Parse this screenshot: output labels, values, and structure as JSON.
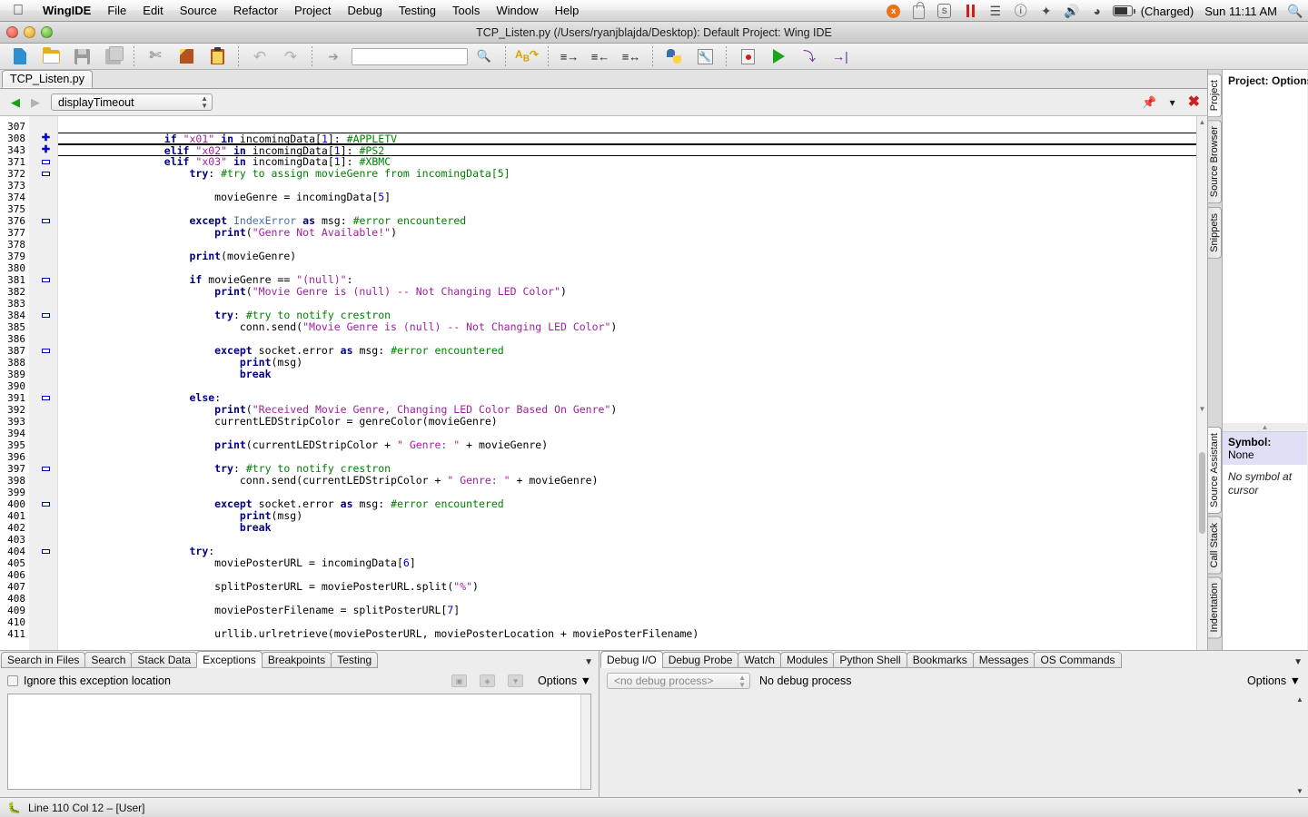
{
  "menubar": {
    "apple": "apple-logo",
    "items": [
      "WingIDE",
      "File",
      "Edit",
      "Source",
      "Refactor",
      "Project",
      "Debug",
      "Testing",
      "Tools",
      "Window",
      "Help"
    ],
    "status_icons": [
      "crashplan-icon",
      "lock-icon",
      "shield-icon",
      "pause-icon",
      "wifi-icon",
      "alert-icon",
      "bluetooth-icon",
      "volume-icon",
      "timemachine-icon",
      "battery-icon"
    ],
    "battery_text": "(Charged)",
    "clock": "Sun 11:11 AM",
    "search_icon": "spotlight-search-icon"
  },
  "window": {
    "title": "TCP_Listen.py (/Users/ryanjblajda/Desktop): Default Project: Wing IDE"
  },
  "toolbar": {
    "buttons": [
      {
        "name": "new-file-icon",
        "label": "New File"
      },
      {
        "name": "open-file-icon",
        "label": "Open File"
      },
      {
        "name": "save-file-icon",
        "label": "Save"
      },
      {
        "name": "save-all-icon",
        "label": "Save All"
      },
      {
        "name": "cut-icon",
        "label": "Cut"
      },
      {
        "name": "copy-icon",
        "label": "Copy"
      },
      {
        "name": "paste-icon",
        "label": "Paste"
      },
      {
        "name": "undo-icon",
        "label": "Undo"
      },
      {
        "name": "redo-icon",
        "label": "Redo"
      },
      {
        "name": "select-pointer-icon",
        "label": "Select"
      },
      {
        "name": "search-input",
        "label": "Search"
      },
      {
        "name": "search-magnifier-icon",
        "label": "Find"
      },
      {
        "name": "replace-abc-icon",
        "label": "Replace"
      },
      {
        "name": "indent-right-icon",
        "label": "Indent"
      },
      {
        "name": "indent-left-icon",
        "label": "Outdent"
      },
      {
        "name": "indent-toggle-icon",
        "label": "Toggle Indent"
      },
      {
        "name": "python-shell-icon",
        "label": "Python Shell"
      },
      {
        "name": "debug-probe-icon",
        "label": "Debug Probe"
      },
      {
        "name": "toggle-breakpoint-icon",
        "label": "Breakpoint"
      },
      {
        "name": "run-icon",
        "label": "Run"
      },
      {
        "name": "step-into-icon",
        "label": "Step Into"
      },
      {
        "name": "step-over-icon",
        "label": "Step Over"
      }
    ],
    "search_value": ""
  },
  "editor": {
    "tab": "TCP_Listen.py",
    "nav_back": "◀",
    "nav_forward": "▶",
    "symbol_combo": "displayTimeout",
    "right_icons": [
      "pin-icon",
      "chevron-down-icon",
      "close-icon"
    ],
    "lines": [
      {
        "n": "307",
        "mark": "",
        "sel": false,
        "tokens": []
      },
      {
        "n": "308",
        "mark": "plus",
        "sel": true,
        "tokens": [
          {
            "t": "                ",
            "c": "pln"
          },
          {
            "t": "if",
            "c": "kw"
          },
          {
            "t": " ",
            "c": "pln"
          },
          {
            "t": "\"x01\"",
            "c": "str"
          },
          {
            "t": " ",
            "c": "pln"
          },
          {
            "t": "in",
            "c": "kw"
          },
          {
            "t": " incomingData[",
            "c": "pln"
          },
          {
            "t": "1",
            "c": "num"
          },
          {
            "t": "]: ",
            "c": "pln"
          },
          {
            "t": "#APPLETV",
            "c": "cmt"
          }
        ]
      },
      {
        "n": "343",
        "mark": "plus",
        "sel": true,
        "tokens": [
          {
            "t": "                ",
            "c": "pln"
          },
          {
            "t": "elif",
            "c": "kw"
          },
          {
            "t": " ",
            "c": "pln"
          },
          {
            "t": "\"x02\"",
            "c": "str"
          },
          {
            "t": " ",
            "c": "pln"
          },
          {
            "t": "in",
            "c": "kw"
          },
          {
            "t": " incomingData[",
            "c": "pln"
          },
          {
            "t": "1",
            "c": "num"
          },
          {
            "t": "]: ",
            "c": "pln"
          },
          {
            "t": "#PS2",
            "c": "cmt"
          }
        ]
      },
      {
        "n": "371",
        "mark": "minus",
        "sel": false,
        "tokens": [
          {
            "t": "                ",
            "c": "pln"
          },
          {
            "t": "elif",
            "c": "kw"
          },
          {
            "t": " ",
            "c": "pln"
          },
          {
            "t": "\"x03\"",
            "c": "str"
          },
          {
            "t": " ",
            "c": "pln"
          },
          {
            "t": "in",
            "c": "kw"
          },
          {
            "t": " incomingData[",
            "c": "pln"
          },
          {
            "t": "1",
            "c": "num"
          },
          {
            "t": "]: ",
            "c": "pln"
          },
          {
            "t": "#XBMC",
            "c": "cmt"
          }
        ]
      },
      {
        "n": "372",
        "mark": "minus",
        "sel": false,
        "tokens": [
          {
            "t": "                    ",
            "c": "pln"
          },
          {
            "t": "try",
            "c": "kw"
          },
          {
            "t": ": ",
            "c": "pln"
          },
          {
            "t": "#try to assign movieGenre from incomingData[5]",
            "c": "cmt"
          }
        ]
      },
      {
        "n": "373",
        "mark": "",
        "sel": false,
        "tokens": []
      },
      {
        "n": "374",
        "mark": "",
        "sel": false,
        "tokens": [
          {
            "t": "                        movieGenre = incomingData[",
            "c": "pln"
          },
          {
            "t": "5",
            "c": "num"
          },
          {
            "t": "]",
            "c": "pln"
          }
        ]
      },
      {
        "n": "375",
        "mark": "",
        "sel": false,
        "tokens": []
      },
      {
        "n": "376",
        "mark": "minus",
        "sel": false,
        "tokens": [
          {
            "t": "                    ",
            "c": "pln"
          },
          {
            "t": "except",
            "c": "kw"
          },
          {
            "t": " ",
            "c": "pln"
          },
          {
            "t": "IndexError",
            "c": "bi"
          },
          {
            "t": " ",
            "c": "pln"
          },
          {
            "t": "as",
            "c": "kw"
          },
          {
            "t": " msg: ",
            "c": "pln"
          },
          {
            "t": "#error encountered",
            "c": "cmt"
          }
        ]
      },
      {
        "n": "377",
        "mark": "",
        "sel": false,
        "tokens": [
          {
            "t": "                        ",
            "c": "pln"
          },
          {
            "t": "print",
            "c": "kw"
          },
          {
            "t": "(",
            "c": "pln"
          },
          {
            "t": "\"Genre Not Available!\"",
            "c": "str"
          },
          {
            "t": ")",
            "c": "pln"
          }
        ]
      },
      {
        "n": "378",
        "mark": "",
        "sel": false,
        "tokens": []
      },
      {
        "n": "379",
        "mark": "",
        "sel": false,
        "tokens": [
          {
            "t": "                    ",
            "c": "pln"
          },
          {
            "t": "print",
            "c": "kw"
          },
          {
            "t": "(movieGenre)",
            "c": "pln"
          }
        ]
      },
      {
        "n": "380",
        "mark": "",
        "sel": false,
        "tokens": []
      },
      {
        "n": "381",
        "mark": "minus",
        "sel": false,
        "tokens": [
          {
            "t": "                    ",
            "c": "pln"
          },
          {
            "t": "if",
            "c": "kw"
          },
          {
            "t": " movieGenre == ",
            "c": "pln"
          },
          {
            "t": "\"(null)\"",
            "c": "str"
          },
          {
            "t": ":",
            "c": "pln"
          }
        ]
      },
      {
        "n": "382",
        "mark": "",
        "sel": false,
        "tokens": [
          {
            "t": "                        ",
            "c": "pln"
          },
          {
            "t": "print",
            "c": "kw"
          },
          {
            "t": "(",
            "c": "pln"
          },
          {
            "t": "\"Movie Genre is (null) -- Not Changing LED Color\"",
            "c": "str"
          },
          {
            "t": ")",
            "c": "pln"
          }
        ]
      },
      {
        "n": "383",
        "mark": "",
        "sel": false,
        "tokens": []
      },
      {
        "n": "384",
        "mark": "minus",
        "sel": false,
        "tokens": [
          {
            "t": "                        ",
            "c": "pln"
          },
          {
            "t": "try",
            "c": "kw"
          },
          {
            "t": ": ",
            "c": "pln"
          },
          {
            "t": "#try to notify crestron",
            "c": "cmt"
          }
        ]
      },
      {
        "n": "385",
        "mark": "",
        "sel": false,
        "tokens": [
          {
            "t": "                            conn.send(",
            "c": "pln"
          },
          {
            "t": "\"Movie Genre is (null) -- Not Changing LED Color\"",
            "c": "str"
          },
          {
            "t": ")",
            "c": "pln"
          }
        ]
      },
      {
        "n": "386",
        "mark": "",
        "sel": false,
        "tokens": []
      },
      {
        "n": "387",
        "mark": "minus",
        "sel": false,
        "tokens": [
          {
            "t": "                        ",
            "c": "pln"
          },
          {
            "t": "except",
            "c": "kw"
          },
          {
            "t": " socket.error ",
            "c": "pln"
          },
          {
            "t": "as",
            "c": "kw"
          },
          {
            "t": " msg: ",
            "c": "pln"
          },
          {
            "t": "#error encountered",
            "c": "cmt"
          }
        ]
      },
      {
        "n": "388",
        "mark": "",
        "sel": false,
        "tokens": [
          {
            "t": "                            ",
            "c": "pln"
          },
          {
            "t": "print",
            "c": "kw"
          },
          {
            "t": "(msg)",
            "c": "pln"
          }
        ]
      },
      {
        "n": "389",
        "mark": "",
        "sel": false,
        "tokens": [
          {
            "t": "                            ",
            "c": "pln"
          },
          {
            "t": "break",
            "c": "kw"
          }
        ]
      },
      {
        "n": "390",
        "mark": "",
        "sel": false,
        "tokens": []
      },
      {
        "n": "391",
        "mark": "minus",
        "sel": false,
        "tokens": [
          {
            "t": "                    ",
            "c": "pln"
          },
          {
            "t": "else",
            "c": "kw"
          },
          {
            "t": ":",
            "c": "pln"
          }
        ]
      },
      {
        "n": "392",
        "mark": "",
        "sel": false,
        "tokens": [
          {
            "t": "                        ",
            "c": "pln"
          },
          {
            "t": "print",
            "c": "kw"
          },
          {
            "t": "(",
            "c": "pln"
          },
          {
            "t": "\"Received Movie Genre, Changing LED Color Based On Genre\"",
            "c": "str"
          },
          {
            "t": ")",
            "c": "pln"
          }
        ]
      },
      {
        "n": "393",
        "mark": "",
        "sel": false,
        "tokens": [
          {
            "t": "                        currentLEDStripColor = genreColor(movieGenre)",
            "c": "pln"
          }
        ]
      },
      {
        "n": "394",
        "mark": "",
        "sel": false,
        "tokens": []
      },
      {
        "n": "395",
        "mark": "",
        "sel": false,
        "tokens": [
          {
            "t": "                        ",
            "c": "pln"
          },
          {
            "t": "print",
            "c": "kw"
          },
          {
            "t": "(currentLEDStripColor + ",
            "c": "pln"
          },
          {
            "t": "\" Genre: \"",
            "c": "str"
          },
          {
            "t": " + movieGenre)",
            "c": "pln"
          }
        ]
      },
      {
        "n": "396",
        "mark": "",
        "sel": false,
        "tokens": []
      },
      {
        "n": "397",
        "mark": "minus",
        "sel": false,
        "tokens": [
          {
            "t": "                        ",
            "c": "pln"
          },
          {
            "t": "try",
            "c": "kw"
          },
          {
            "t": ": ",
            "c": "pln"
          },
          {
            "t": "#try to notify crestron",
            "c": "cmt"
          }
        ]
      },
      {
        "n": "398",
        "mark": "",
        "sel": false,
        "tokens": [
          {
            "t": "                            conn.send(currentLEDStripColor + ",
            "c": "pln"
          },
          {
            "t": "\" Genre: \"",
            "c": "str"
          },
          {
            "t": " + movieGenre)",
            "c": "pln"
          }
        ]
      },
      {
        "n": "399",
        "mark": "",
        "sel": false,
        "tokens": []
      },
      {
        "n": "400",
        "mark": "minus",
        "sel": false,
        "tokens": [
          {
            "t": "                        ",
            "c": "pln"
          },
          {
            "t": "except",
            "c": "kw"
          },
          {
            "t": " socket.error ",
            "c": "pln"
          },
          {
            "t": "as",
            "c": "kw"
          },
          {
            "t": " msg: ",
            "c": "pln"
          },
          {
            "t": "#error encountered",
            "c": "cmt"
          }
        ]
      },
      {
        "n": "401",
        "mark": "",
        "sel": false,
        "tokens": [
          {
            "t": "                            ",
            "c": "pln"
          },
          {
            "t": "print",
            "c": "kw"
          },
          {
            "t": "(msg)",
            "c": "pln"
          }
        ]
      },
      {
        "n": "402",
        "mark": "",
        "sel": false,
        "tokens": [
          {
            "t": "                            ",
            "c": "pln"
          },
          {
            "t": "break",
            "c": "kw"
          }
        ]
      },
      {
        "n": "403",
        "mark": "",
        "sel": false,
        "tokens": []
      },
      {
        "n": "404",
        "mark": "minus",
        "sel": false,
        "tokens": [
          {
            "t": "                    ",
            "c": "pln"
          },
          {
            "t": "try",
            "c": "kw"
          },
          {
            "t": ":",
            "c": "pln"
          }
        ]
      },
      {
        "n": "405",
        "mark": "",
        "sel": false,
        "tokens": [
          {
            "t": "                        moviePosterURL = incomingData[",
            "c": "pln"
          },
          {
            "t": "6",
            "c": "num"
          },
          {
            "t": "]",
            "c": "pln"
          }
        ]
      },
      {
        "n": "406",
        "mark": "",
        "sel": false,
        "tokens": []
      },
      {
        "n": "407",
        "mark": "",
        "sel": false,
        "tokens": [
          {
            "t": "                        splitPosterURL = moviePosterURL.split(",
            "c": "pln"
          },
          {
            "t": "\"%\"",
            "c": "str"
          },
          {
            "t": ")",
            "c": "pln"
          }
        ]
      },
      {
        "n": "408",
        "mark": "",
        "sel": false,
        "tokens": []
      },
      {
        "n": "409",
        "mark": "",
        "sel": false,
        "tokens": [
          {
            "t": "                        moviePosterFilename = splitPosterURL[",
            "c": "pln"
          },
          {
            "t": "7",
            "c": "num"
          },
          {
            "t": "]",
            "c": "pln"
          }
        ]
      },
      {
        "n": "410",
        "mark": "",
        "sel": false,
        "tokens": []
      },
      {
        "n": "411",
        "mark": "",
        "sel": false,
        "tokens": [
          {
            "t": "                        urllib.urlretrieve(moviePosterURL, moviePosterLocation + moviePosterFilename)",
            "c": "pln"
          }
        ]
      }
    ]
  },
  "right_rail_top": {
    "tabs": [
      "Project",
      "Source Browser",
      "Snippets"
    ],
    "active": "Project",
    "panel_title": "Project: Options"
  },
  "right_rail_bottom": {
    "tabs": [
      "Source Assistant",
      "Call Stack",
      "Indentation"
    ],
    "active": "Source Assistant",
    "symbol_label": "Symbol:",
    "symbol_value": "None",
    "note": "No symbol at cursor"
  },
  "bottom_left": {
    "tabs": [
      "Search in Files",
      "Search",
      "Stack Data",
      "Exceptions",
      "Breakpoints",
      "Testing"
    ],
    "active": "Exceptions",
    "checkbox_label": "Ignore this exception location",
    "checkbox_checked": false,
    "icon_buttons": [
      "exception-step-icon",
      "exception-view-icon",
      "exception-clear-icon"
    ],
    "options_label": "Options",
    "caret": "▼"
  },
  "bottom_right": {
    "tabs": [
      "Debug I/O",
      "Debug Probe",
      "Watch",
      "Modules",
      "Python Shell",
      "Bookmarks",
      "Messages",
      "OS Commands"
    ],
    "active": "Debug I/O",
    "process_combo": "<no debug process>",
    "process_status": "No debug process",
    "options_label": "Options",
    "caret": "▼"
  },
  "statusbar": {
    "icon": "bug-icon",
    "text": "Line 110 Col 12 – [User]"
  },
  "colors": {
    "keyword": "#000080",
    "string": "#a020a0",
    "comment": "#008000",
    "number": "#0000d0",
    "builtin": "#4a6fa5",
    "accent_red": "#cc1f1f",
    "run_green": "#1aa51a"
  }
}
